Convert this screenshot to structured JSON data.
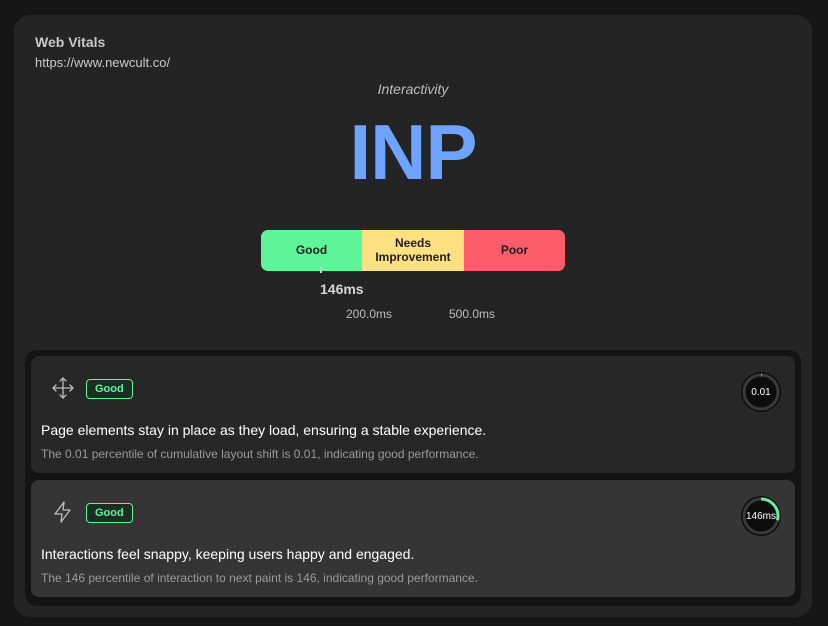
{
  "header": {
    "title": "Web Vitals",
    "url": "https://www.newcult.co/"
  },
  "metric": {
    "category": "Interactivity",
    "name": "INP",
    "current_value": "146ms",
    "thresholds": [
      "200.0ms",
      "500.0ms"
    ],
    "scale": {
      "good": "Good",
      "needs": "Needs Improvement",
      "poor": "Poor"
    },
    "colors": {
      "accent": "#6ea4ff",
      "good": "#5ef59b",
      "needs": "#fde07f",
      "poor": "#fd5d6b"
    }
  },
  "items": [
    {
      "icon": "move-arrows-icon",
      "badge": "Good",
      "title": "Page elements stay in place as they load, ensuring a stable experience.",
      "description": "The 0.01 percentile of cumulative layout shift is 0.01, indicating good performance.",
      "gauge_label": "0.01",
      "gauge_fraction": 0.01
    },
    {
      "icon": "lightning-icon",
      "badge": "Good",
      "title": "Interactions feel snappy, keeping users happy and engaged.",
      "description": "The 146 percentile of interaction to next paint is 146, indicating good performance.",
      "gauge_label": "146ms",
      "gauge_fraction": 0.29
    }
  ]
}
